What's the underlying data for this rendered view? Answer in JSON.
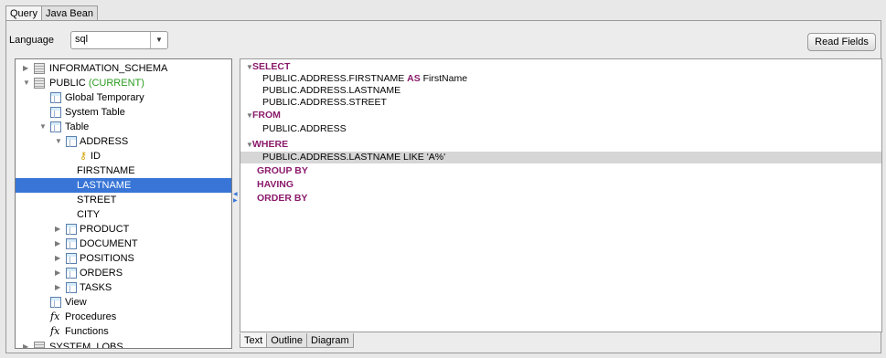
{
  "top_tabs": [
    {
      "label": "Query",
      "active": true
    },
    {
      "label": "Java Bean",
      "active": false
    }
  ],
  "language": {
    "label": "Language",
    "value": "sql"
  },
  "read_fields_label": "Read Fields",
  "tree": {
    "information_schema": "INFORMATION_SCHEMA",
    "public": "PUBLIC",
    "public_current": "(CURRENT)",
    "global_temporary": "Global Temporary",
    "system_table": "System Table",
    "table": "Table",
    "address": "ADDRESS",
    "id": "ID",
    "firstname": "FIRSTNAME",
    "lastname": "LASTNAME",
    "street": "STREET",
    "city": "CITY",
    "product": "PRODUCT",
    "document": "DOCUMENT",
    "positions": "POSITIONS",
    "orders": "ORDERS",
    "tasks": "TASKS",
    "view": "View",
    "procedures": "Procedures",
    "functions": "Functions",
    "system_lobs": "SYSTEM_LOBS"
  },
  "sql": {
    "select": "SELECT",
    "col1": "PUBLIC.ADDRESS.FIRSTNAME",
    "as": "AS",
    "alias": "FirstName",
    "col2": "PUBLIC.ADDRESS.LASTNAME",
    "col3": "PUBLIC.ADDRESS.STREET",
    "from": "FROM",
    "table": "PUBLIC.ADDRESS",
    "where": "WHERE",
    "cond": "PUBLIC.ADDRESS.LASTNAME LIKE 'A%'",
    "group_by": "GROUP BY",
    "having": "HAVING",
    "order_by": "ORDER BY"
  },
  "bottom_tabs": [
    {
      "label": "Text",
      "active": true
    },
    {
      "label": "Outline",
      "active": false
    },
    {
      "label": "Diagram",
      "active": false
    }
  ],
  "colors": {
    "selection": "#3875d7",
    "keyword": "#8b1a6b",
    "current": "#2a9b1e"
  }
}
